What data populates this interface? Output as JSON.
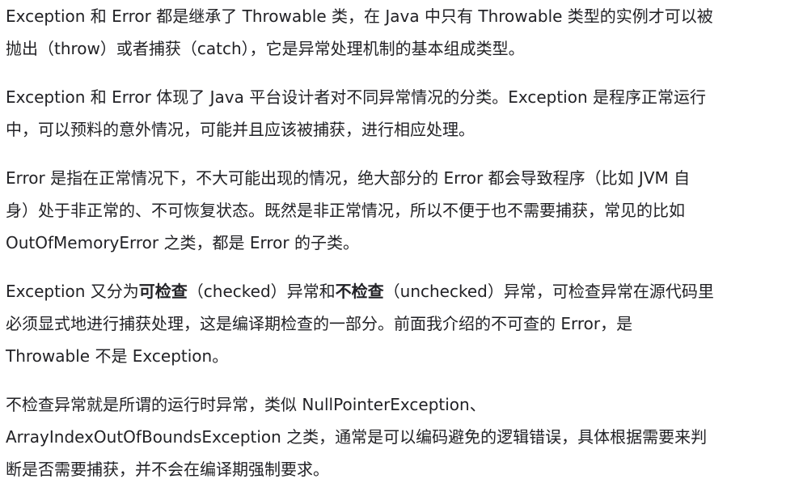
{
  "article": {
    "paragraphs": [
      {
        "lines": [
          "Exception 和 Error 都是继承了 Throwable 类，在 Java 中只有 Throwable 类型的实例才可以被",
          "抛出（throw）或者捕获（catch），它是异常处理机制的基本组成类型。"
        ]
      },
      {
        "lines": [
          "Exception 和 Error 体现了 Java 平台设计者对不同异常情况的分类。Exception 是程序正常运行",
          "中，可以预料的意外情况，可能并且应该被捕获，进行相应处理。"
        ]
      },
      {
        "lines": [
          "Error 是指在正常情况下，不大可能出现的情况，绝大部分的 Error 都会导致程序（比如 JVM 自",
          "身）处于非正常的、不可恢复状态。既然是非正常情况，所以不便于也不需要捕获，常见的比如",
          "OutOfMemoryError 之类，都是 Error 的子类。"
        ]
      },
      {
        "line1": {
          "a": "Exception 又分为",
          "b": "可检查",
          "c": "（checked）异常和",
          "d": "不检查",
          "e": "（unchecked）异常，可检查异常在源代码里"
        },
        "lines": [
          "必须显式地进行捕获处理，这是编译期检查的一部分。前面我介绍的不可查的 Error，是",
          "Throwable 不是 Exception。"
        ]
      },
      {
        "lines": [
          "不检查异常就是所谓的运行时异常，类似 NullPointerException、",
          "ArrayIndexOutOfBoundsException 之类，通常是可以编码避免的逻辑错误，具体根据需要来判",
          "断是否需要捕获，并不会在编译期强制要求。"
        ]
      }
    ]
  }
}
